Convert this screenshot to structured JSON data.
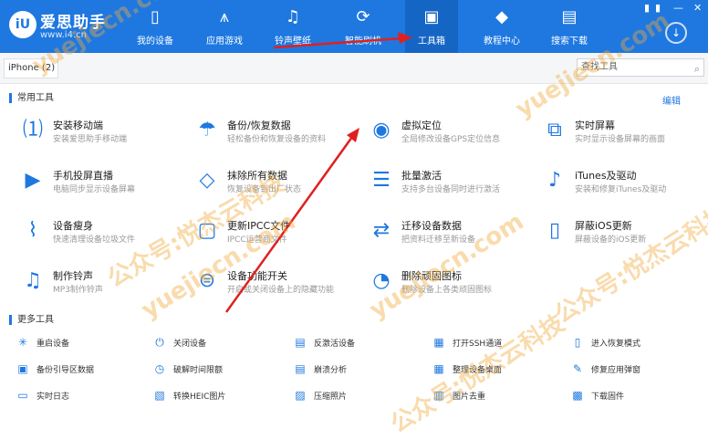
{
  "app": {
    "brand": "爱思助手",
    "url": "www.i4.cn",
    "logo_text": "iU"
  },
  "nav": [
    {
      "label": "我的设备",
      "icon": "phone-icon"
    },
    {
      "label": "应用游戏",
      "icon": "app-store-icon"
    },
    {
      "label": "铃声壁纸",
      "icon": "music-icon"
    },
    {
      "label": "智能刷机",
      "icon": "flash-icon"
    },
    {
      "label": "工具箱",
      "icon": "toolbox-icon"
    },
    {
      "label": "教程中心",
      "icon": "graduation-cap-icon"
    },
    {
      "label": "搜索下载",
      "icon": "download-icon"
    }
  ],
  "device_tab": "iPhone (2)",
  "search": {
    "placeholder": "查找工具"
  },
  "common_tools": {
    "title": "常用工具",
    "edit": "编辑",
    "items": [
      {
        "name": "安装移动端",
        "desc": "安装爱思助手移动端",
        "icon": "install-mobile-icon"
      },
      {
        "name": "备份/恢复数据",
        "desc": "轻松备份和恢复设备的资料",
        "icon": "umbrella-icon"
      },
      {
        "name": "虚拟定位",
        "desc": "全局修改设备GPS定位信息",
        "icon": "location-pin-icon"
      },
      {
        "name": "实时屏幕",
        "desc": "实时显示设备屏幕的画面",
        "icon": "screen-mirror-icon"
      },
      {
        "name": "手机投屏直播",
        "desc": "电脑同步显示设备屏幕",
        "icon": "screen-cast-icon"
      },
      {
        "name": "抹除所有数据",
        "desc": "恢复设备到出厂状态",
        "icon": "eraser-icon"
      },
      {
        "name": "批量激活",
        "desc": "支持多台设备同时进行激活",
        "icon": "batch-activate-icon"
      },
      {
        "name": "iTunes及驱动",
        "desc": "安装和修复iTunes及驱动",
        "icon": "itunes-icon"
      },
      {
        "name": "设备瘦身",
        "desc": "快速清理设备垃圾文件",
        "icon": "broom-icon"
      },
      {
        "name": "更新IPCC文件",
        "desc": "IPCC运营商文件",
        "icon": "ipcc-icon"
      },
      {
        "name": "迁移设备数据",
        "desc": "把资料迁移至新设备",
        "icon": "transfer-icon"
      },
      {
        "name": "屏蔽iOS更新",
        "desc": "屏蔽设备的iOS更新",
        "icon": "block-update-icon"
      },
      {
        "name": "制作铃声",
        "desc": "MP3制作铃声",
        "icon": "ringtone-icon"
      },
      {
        "name": "设备功能开关",
        "desc": "开启或关闭设备上的隐藏功能",
        "icon": "toggle-icon"
      },
      {
        "name": "删除顽固图标",
        "desc": "删除设备上各类顽固图标",
        "icon": "remove-icon-icon"
      }
    ]
  },
  "more_tools": {
    "title": "更多工具",
    "items": [
      {
        "name": "重启设备",
        "icon": "restart-icon"
      },
      {
        "name": "关闭设备",
        "icon": "power-icon"
      },
      {
        "name": "反激活设备",
        "icon": "deactivate-icon"
      },
      {
        "name": "打开SSH通道",
        "icon": "ssh-icon"
      },
      {
        "name": "进入恢复模式",
        "icon": "recovery-icon"
      },
      {
        "name": "备份引导区数据",
        "icon": "backup-boot-icon"
      },
      {
        "name": "破解时间限额",
        "icon": "clock-icon"
      },
      {
        "name": "崩溃分析",
        "icon": "crash-analysis-icon"
      },
      {
        "name": "整理设备桌面",
        "icon": "grid-icon"
      },
      {
        "name": "修复应用弹窗",
        "icon": "repair-icon"
      },
      {
        "name": "实时日志",
        "icon": "log-icon"
      },
      {
        "name": "转换HEIC图片",
        "icon": "heic-icon"
      },
      {
        "name": "压缩照片",
        "icon": "compress-photo-icon"
      },
      {
        "name": "图片去重",
        "icon": "dedupe-icon"
      },
      {
        "name": "下载固件",
        "icon": "firmware-download-icon"
      }
    ]
  },
  "watermarks": [
    "yuejiecn.com",
    "公众号:悦杰云科技"
  ],
  "colors": {
    "primary": "#1e78e0",
    "arrow": "#e02020",
    "watermark": "#f0aa3c"
  }
}
